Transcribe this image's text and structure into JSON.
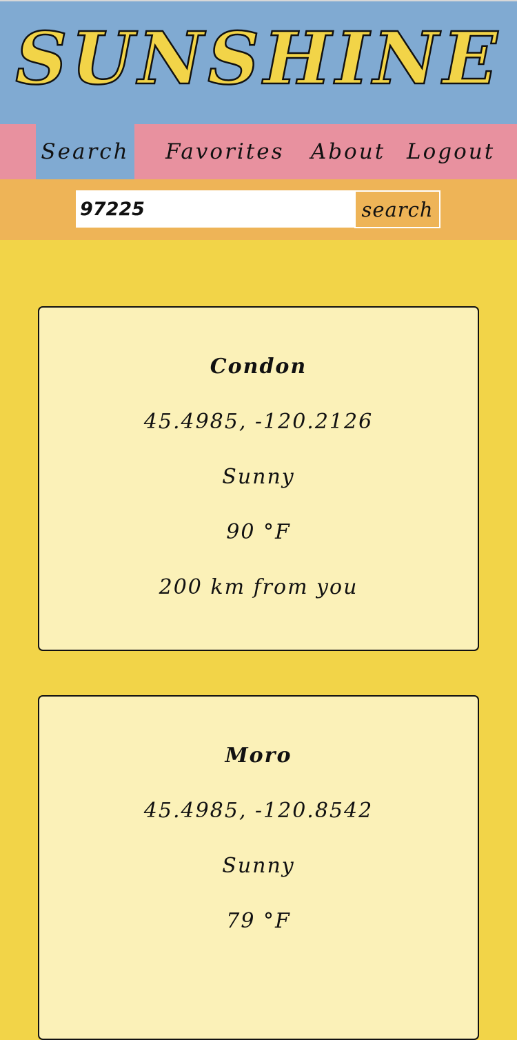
{
  "app": {
    "logo_text": "SUNSHINE",
    "colors": {
      "header_bg": "#80aad2",
      "nav_bg": "#e8919f",
      "search_bg": "#eeb457",
      "page_bg": "#f2d448",
      "card_bg": "#fbf1b8"
    }
  },
  "nav": {
    "items": [
      {
        "label": "Search",
        "active": true
      },
      {
        "label": "Favorites",
        "active": false
      },
      {
        "label": "About",
        "active": false
      },
      {
        "label": "Logout",
        "active": false
      }
    ]
  },
  "search": {
    "value": "97225",
    "button_label": "search"
  },
  "results": [
    {
      "name": "Condon",
      "coords": "45.4985, -120.2126",
      "condition": "Sunny",
      "temperature": "90 °F",
      "distance": "200 km from you"
    },
    {
      "name": "Moro",
      "coords": "45.4985, -120.8542",
      "condition": "Sunny",
      "temperature": "79 °F"
    }
  ]
}
